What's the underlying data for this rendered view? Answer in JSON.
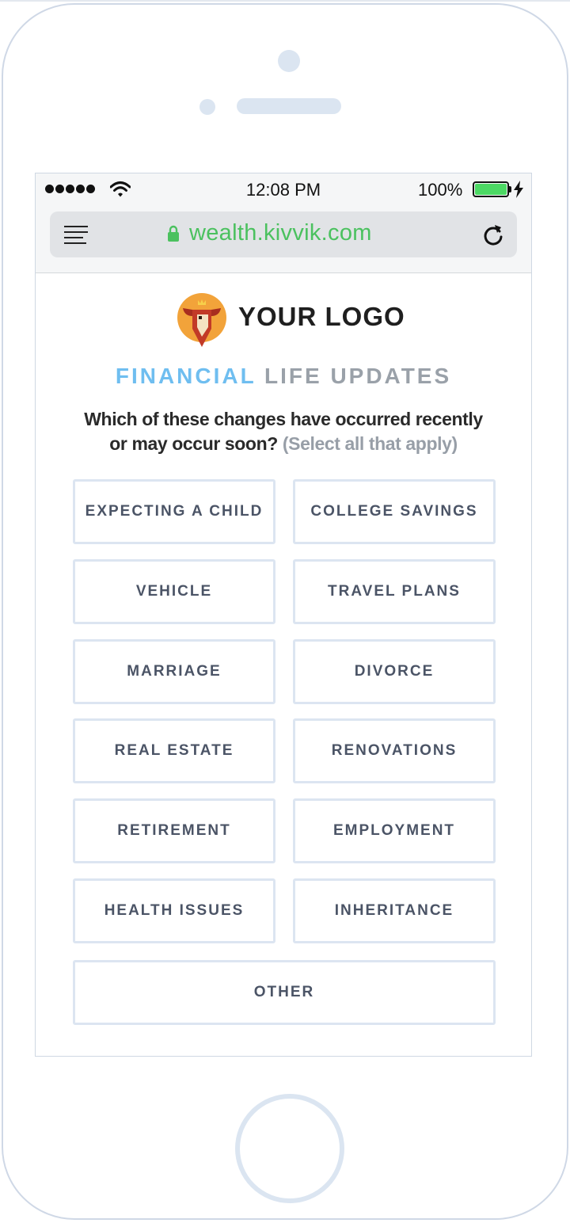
{
  "status_bar": {
    "time": "12:08 PM",
    "battery_percent": "100%",
    "battery_color": "#4cd964"
  },
  "browser": {
    "url": "wealth.kivvik.com",
    "url_color": "#4bc15f",
    "icons": [
      "menu-icon",
      "lock-icon",
      "reload-icon"
    ]
  },
  "brand": {
    "logo_text": "YOUR LOGO",
    "logo_icon": "bull-logo-icon"
  },
  "page": {
    "title_accent": "FINANCIAL",
    "title_rest": "LIFE UPDATES",
    "accent_color": "#6fbef0",
    "question_line1": "Which of these changes have occurred recently",
    "question_line2": "or may occur soon?",
    "question_hint": "(Select all that apply)"
  },
  "options": [
    "EXPECTING A CHILD",
    "COLLEGE SAVINGS",
    "VEHICLE",
    "TRAVEL PLANS",
    "MARRIAGE",
    "DIVORCE",
    "REAL ESTATE",
    "RENOVATIONS",
    "RETIREMENT",
    "EMPLOYMENT",
    "HEALTH ISSUES",
    "INHERITANCE",
    "OTHER"
  ]
}
